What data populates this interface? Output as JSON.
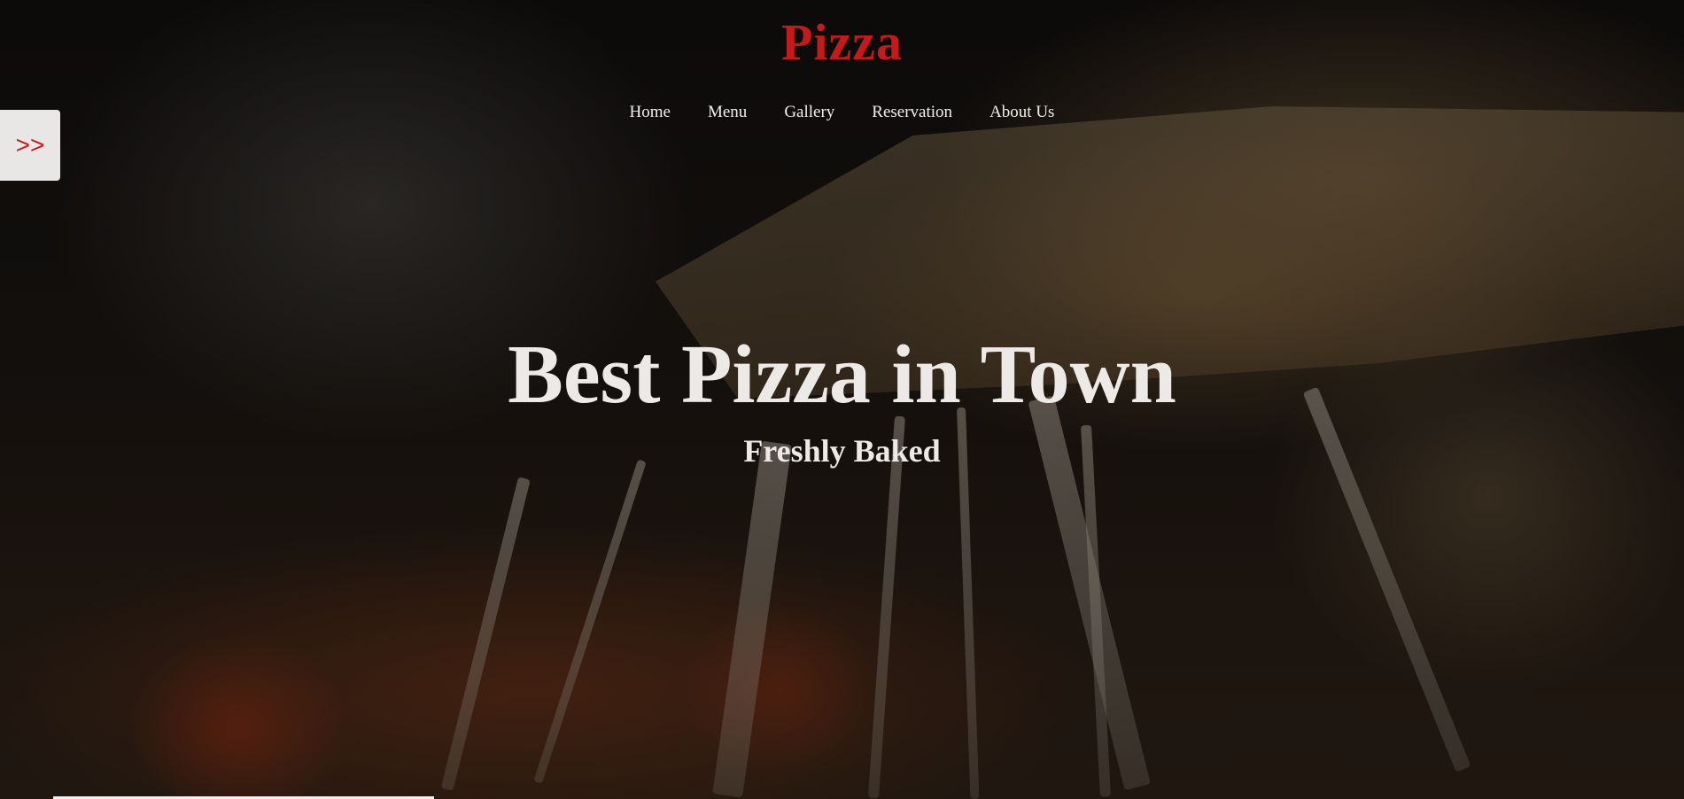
{
  "brand": {
    "logo_text": "Pizza",
    "accent_color": "#c41a1a"
  },
  "nav": {
    "items": [
      {
        "label": "Home"
      },
      {
        "label": "Menu"
      },
      {
        "label": "Gallery"
      },
      {
        "label": "Reservation"
      },
      {
        "label": "About Us"
      }
    ]
  },
  "sidebar_toggle": {
    "icon": "double-chevron-right-icon",
    "glyph": ">>"
  },
  "hero": {
    "headline": "Best Pizza in Town",
    "subheadline": "Freshly Baked",
    "background": "pizza-slice-cheese-pull-photo"
  }
}
